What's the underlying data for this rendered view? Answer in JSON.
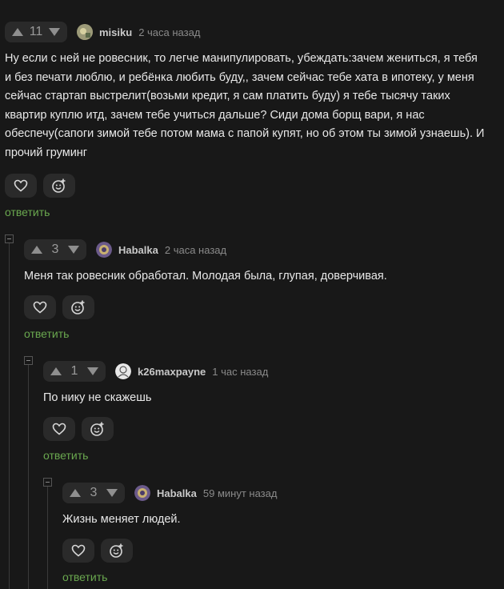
{
  "comments": [
    {
      "rating": "11",
      "author": "misiku",
      "time": "2 часа назад",
      "text": "Ну если с ней не ровесник, то легче манипулировать, убеждать:зачем жениться, я тебя и без печати люблю, и ребёнка любить буду,, зачем сейчас тебе хата в ипотеку, у меня сейчас стартап выстрелит(возьми кредит, я сам платить буду) я тебе тысячу таких квартир куплю итд, зачем тебе учиться дальше? Сиди дома борщ вари, я нас обеспечу(сапоги зимой тебе потом мама с папой купят, но об этом ты зимой узнаешь). И прочий груминг",
      "reply_label": "ответить"
    },
    {
      "rating": "3",
      "author": "Habalka",
      "time": "2 часа назад",
      "text": "Меня так ровесник обработал. Молодая была, глупая, доверчивая.",
      "reply_label": "ответить"
    },
    {
      "rating": "1",
      "author": "k26maxpayne",
      "time": "1 час назад",
      "text": "По нику не скажешь",
      "reply_label": "ответить"
    },
    {
      "rating": "3",
      "author": "Habalka",
      "time": "59 минут назад",
      "text": "Жизнь меняет людей.",
      "reply_label": "ответить"
    }
  ],
  "icons": {
    "upvote": "arrow-up-icon",
    "downvote": "arrow-down-icon",
    "like": "heart-icon",
    "reaction": "emoji-add-icon",
    "collapse": "collapse-icon"
  },
  "colors": {
    "background": "#181818",
    "reply_link": "#6aa84f",
    "button_bg": "#2a2a2a"
  }
}
